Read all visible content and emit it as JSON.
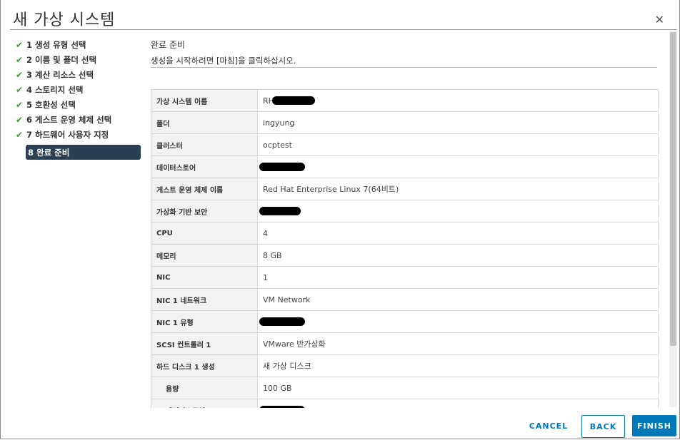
{
  "dialog": {
    "title": "새 가상 시스템",
    "close_glyph": "✕"
  },
  "steps": [
    {
      "label": "1 생성 유형 선택",
      "done": true
    },
    {
      "label": "2 이름 및 폴더 선택",
      "done": true
    },
    {
      "label": "3 계산 리소스 선택",
      "done": true
    },
    {
      "label": "4 스토리지 선택",
      "done": true
    },
    {
      "label": "5 호환성 선택",
      "done": true
    },
    {
      "label": "6 게스트 운영 체제 선택",
      "done": true
    },
    {
      "label": "7 하드웨어 사용자 지정",
      "done": true
    },
    {
      "label": "8 완료 준비",
      "done": false,
      "active": true
    }
  ],
  "section": {
    "title": "완료 준비",
    "subtitle": "생성을 시작하려면 [마침]을 클릭하십시오."
  },
  "summary": [
    {
      "key": "가상 시스템 이름",
      "value": "RH",
      "redacted": true
    },
    {
      "key": "폴더",
      "value": "ingyung"
    },
    {
      "key": "클러스터",
      "value": "ocptest"
    },
    {
      "key": "데이터스토어",
      "value": "",
      "redacted": true
    },
    {
      "key": "게스트 운영 체제 이름",
      "value": "Red Hat Enterprise Linux 7(64비트)"
    },
    {
      "key": "가상화 기반 보안",
      "value": "",
      "redacted": true
    },
    {
      "key": "CPU",
      "value": "4"
    },
    {
      "key": "메모리",
      "value": "8 GB"
    },
    {
      "key": "NIC",
      "value": "1"
    },
    {
      "key": "NIC 1 네트워크",
      "value": "VM Network"
    },
    {
      "key": "NIC 1 유형",
      "value": "",
      "redacted": true
    },
    {
      "key": "SCSI 컨트롤러 1",
      "value": "VMware 반가상화"
    },
    {
      "key": "하드 디스크 1 생성",
      "value": "새 가상 디스크"
    },
    {
      "key": "용량",
      "value": "100 GB",
      "indent": true
    },
    {
      "key": "데이터스토어",
      "value": "",
      "redacted": true,
      "indent": true
    }
  ],
  "buttons": {
    "cancel": "CANCEL",
    "back": "BACK",
    "finish": "FINISH"
  },
  "colors": {
    "accent": "#0079b8",
    "active_step_bg": "#2a3f51",
    "check": "#3f9c35"
  },
  "icons": {
    "step_done": "check-icon",
    "close": "close-icon"
  }
}
